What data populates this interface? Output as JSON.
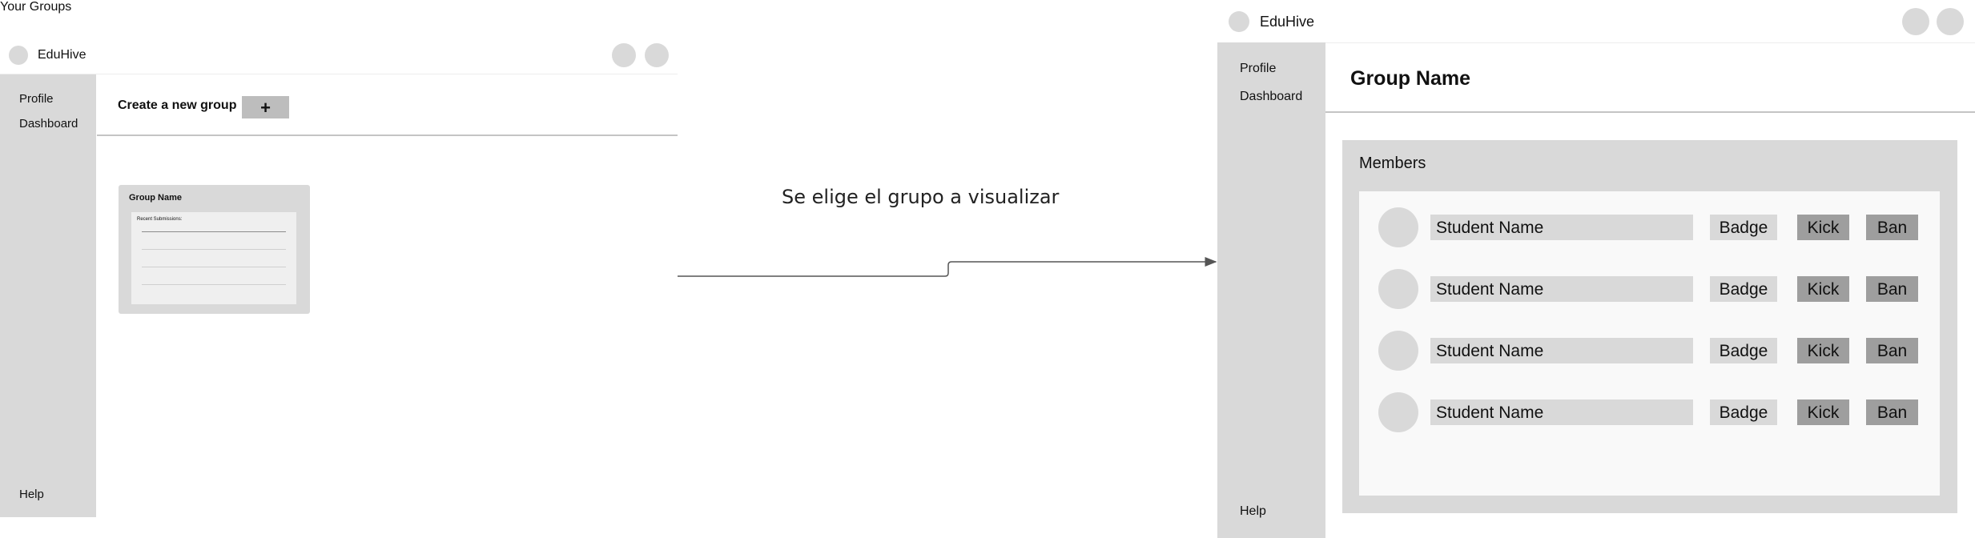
{
  "screen_list": {
    "brand": "EduHive",
    "sidebar": {
      "items": [
        "Profile",
        "Dashboard"
      ],
      "help": "Help"
    },
    "create_label": "Create a new group",
    "create_button": "+",
    "your_groups_label": "Your Groups",
    "group_card": {
      "title": "Group Name",
      "inner_title": "Recent Submissions:"
    }
  },
  "transition": {
    "caption": "Se elige el grupo a visualizar"
  },
  "screen_group": {
    "brand": "EduHive",
    "sidebar": {
      "items": [
        "Profile",
        "Dashboard"
      ],
      "help": "Help"
    },
    "group_title": "Group Name",
    "members_title": "Members",
    "members": [
      {
        "name": "Student Name",
        "badge": "Badge",
        "kick": "Kick",
        "ban": "Ban"
      },
      {
        "name": "Student Name",
        "badge": "Badge",
        "kick": "Kick",
        "ban": "Ban"
      },
      {
        "name": "Student Name",
        "badge": "Badge",
        "kick": "Kick",
        "ban": "Ban"
      },
      {
        "name": "Student Name",
        "badge": "Badge",
        "kick": "Kick",
        "ban": "Ban"
      }
    ]
  },
  "colors": {
    "panel_gray": "#d9d9d9",
    "action_gray": "#9e9e9e",
    "list_background": "#f9f9f9",
    "connector": "#555555"
  }
}
